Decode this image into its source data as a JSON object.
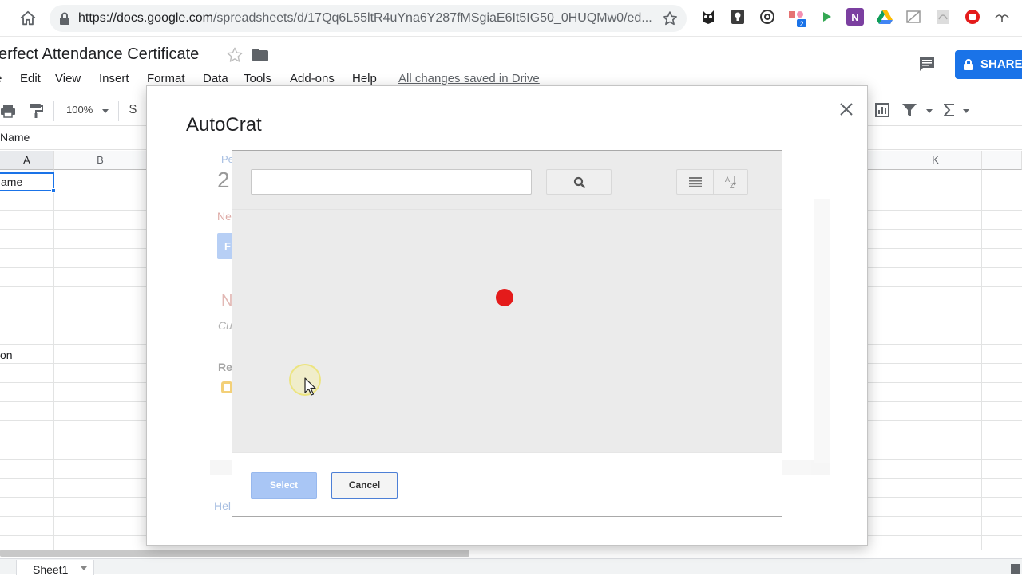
{
  "browser": {
    "url_main": "https://docs.google.com",
    "url_rest": "/spreadsheets/d/17Qq6L55ltR4uYna6Y287fMSgiaE6It5IG50_0HUQMw0/ed...",
    "extension_badge": "2"
  },
  "sheets": {
    "doc_title": "erfect Attendance Certificate",
    "menu": [
      "e",
      "Edit",
      "View",
      "Insert",
      "Format",
      "Data",
      "Tools",
      "Add-ons",
      "Help"
    ],
    "saved_status": "All changes saved in Drive",
    "share_label": "SHARE",
    "zoom": "100%",
    "currency_symbol": "$",
    "name_box": "Name",
    "columns": [
      "A",
      "B",
      "K"
    ],
    "cell_a1": "ame",
    "cell_a11": "on",
    "sheet_tab": "Sheet1"
  },
  "autocrat": {
    "title": "AutoCrat",
    "faded_fragments": {
      "pe": "Pe",
      "num": "2",
      "ne": "Ne",
      "f": "F",
      "n": "N",
      "cu": "Cu",
      "re": "Re",
      "hel": "Hel"
    }
  },
  "picker": {
    "search_value": "",
    "search_icon": "search-icon",
    "list_view_icon": "list-view-icon",
    "sort_icon": "sort-az-icon",
    "select_label": "Select",
    "cancel_label": "Cancel"
  },
  "colors": {
    "accent": "#1a73e8",
    "loading_dot": "#e41b1b",
    "select_disabled": "#a9c6f5"
  }
}
